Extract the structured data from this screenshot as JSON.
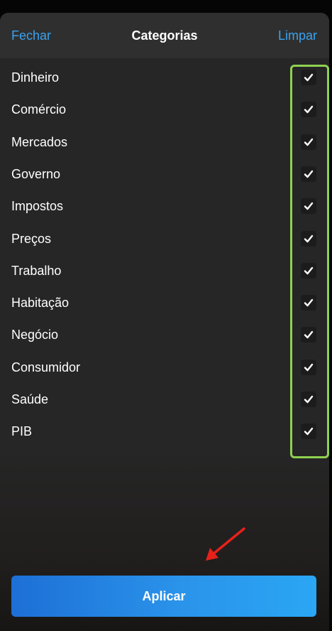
{
  "header": {
    "close_label": "Fechar",
    "title": "Categorias",
    "clear_label": "Limpar"
  },
  "categories": [
    {
      "label": "Dinheiro",
      "checked": true
    },
    {
      "label": "Comércio",
      "checked": true
    },
    {
      "label": "Mercados",
      "checked": true
    },
    {
      "label": "Governo",
      "checked": true
    },
    {
      "label": "Impostos",
      "checked": true
    },
    {
      "label": "Preços",
      "checked": true
    },
    {
      "label": "Trabalho",
      "checked": true
    },
    {
      "label": "Habitação",
      "checked": true
    },
    {
      "label": "Negócio",
      "checked": true
    },
    {
      "label": "Consumidor",
      "checked": true
    },
    {
      "label": "Saúde",
      "checked": true
    },
    {
      "label": "PIB",
      "checked": true
    }
  ],
  "apply_label": "Aplicar",
  "colors": {
    "accent": "#3aa2ef",
    "highlight": "#8fd14f",
    "arrow": "#e8211b",
    "button_start": "#1d6fd6",
    "button_end": "#2aa6f4"
  },
  "icons": {
    "checkbox": "checkmark-icon",
    "annotation": "red-arrow-icon"
  }
}
